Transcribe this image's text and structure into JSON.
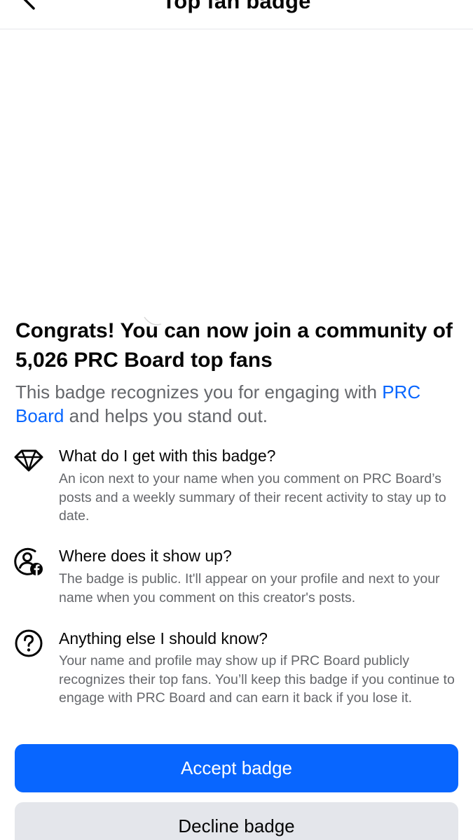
{
  "header": {
    "title": "Top fan badge"
  },
  "headline": "Congrats! You can now join a community of 5,026 PRC Board top fans",
  "subtext": {
    "before": "This badge recognizes you for engaging with ",
    "link": "PRC Board",
    "after": " and helps you stand out."
  },
  "info": [
    {
      "icon": "diamond-icon",
      "title": "What do I get with this badge?",
      "body": "An icon next to your name when you comment on PRC Board’s posts and a weekly summary of their recent activity to stay up to date."
    },
    {
      "icon": "profile-facebook-icon",
      "title": "Where does it show up?",
      "body": "The badge is public. It'll appear on your profile and next to your name when you comment on this creator's posts."
    },
    {
      "icon": "question-circle-icon",
      "title": "Anything else I should know?",
      "body": "Your name and profile may show up if PRC Board publicly recognizes their top fans. You’ll keep this badge if you continue to engage with PRC Board and can earn it back if you lose it."
    }
  ],
  "buttons": {
    "accept": "Accept badge",
    "decline": "Decline badge"
  },
  "colors": {
    "accent": "#0866ff",
    "secondary_button": "#e4e6eb",
    "muted_text": "#65676b"
  }
}
